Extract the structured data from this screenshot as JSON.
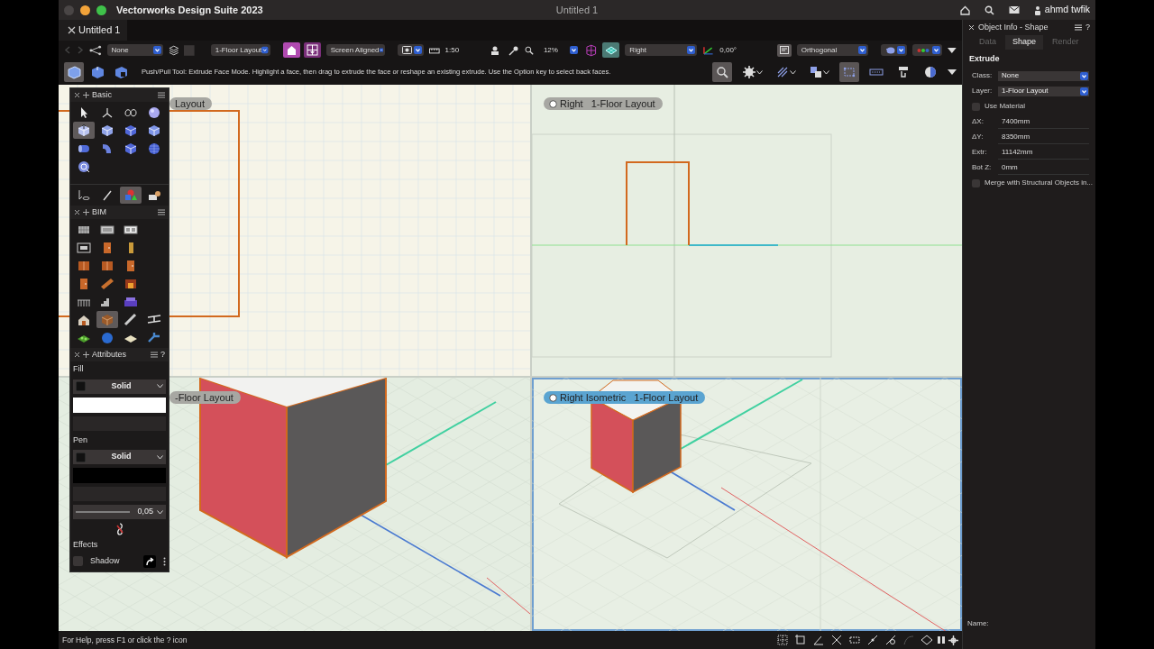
{
  "title_bar": {
    "app_title": "Vectorworks Design Suite 2023",
    "document_title": "Untitled 1",
    "user": "ahmd twfik"
  },
  "document_tab": {
    "label": "Untitled 1"
  },
  "view_bar": {
    "class": "None",
    "layer": "1-Floor Layout",
    "layer_plane_buttons": [
      {
        "selected": true
      },
      {
        "selected": false
      }
    ],
    "plane": "Screen Aligned",
    "scale": "1:50",
    "zoom": "12%",
    "view": "Right",
    "rotation": "0,00°",
    "projection": "Orthogonal"
  },
  "mode_bar": {
    "modes": [
      {
        "selected": true
      },
      {
        "selected": false
      },
      {
        "selected": false
      }
    ],
    "help": "Push/Pull Tool: Extrude Face Mode. Highlight a face, then drag to extrude the face or reshape an existing extrude. Use the Option key to select back faces.",
    "tool_buttons": [
      {
        "selected": true
      },
      {
        "selected": false
      },
      {
        "selected": false
      },
      {
        "selected": false
      },
      {
        "selected": true
      },
      {
        "selected": false
      },
      {
        "selected": false
      },
      {
        "selected": false
      }
    ]
  },
  "viewports": [
    {
      "kind": "plan",
      "layer": "Layout",
      "selected": false
    },
    {
      "kind": "elevation",
      "view": "Right",
      "layer": "1-Floor Layout",
      "selected": false
    },
    {
      "kind": "close_up",
      "layer": "-Floor Layout",
      "selected": false
    },
    {
      "kind": "isometric",
      "view": "Right Isometric",
      "layer": "1-Floor Layout",
      "selected": true
    }
  ],
  "basic_palette": {
    "title": "Basic",
    "tools": [
      {
        "selected": false
      },
      {
        "selected": false
      },
      {
        "selected": false
      },
      {
        "selected": false
      },
      {
        "selected": true
      },
      {
        "selected": false
      },
      {
        "selected": false
      },
      {
        "selected": false
      },
      {
        "selected": false
      },
      {
        "selected": false
      },
      {
        "selected": false
      },
      {
        "selected": false
      },
      {
        "selected": false
      }
    ],
    "tool_sets": [
      {
        "selected": false
      },
      {
        "selected": false
      },
      {
        "selected": true
      },
      {
        "selected": false
      }
    ]
  },
  "bim_palette": {
    "title": "BIM",
    "tools": [
      {
        "selected": false
      },
      {
        "selected": false
      },
      {
        "selected": false
      },
      {
        "selected": false
      },
      {
        "selected": false
      },
      {
        "selected": false
      },
      {
        "selected": false
      },
      {
        "selected": false
      },
      {
        "selected": false
      },
      {
        "selected": false
      },
      {
        "selected": false
      },
      {
        "selected": false
      },
      {
        "selected": false
      },
      {
        "selected": false
      },
      {
        "selected": false
      },
      {
        "selected": false
      },
      {
        "selected": true
      },
      {
        "selected": false
      },
      {
        "selected": false
      },
      {
        "selected": false
      },
      {
        "selected": false
      },
      {
        "selected": false
      },
      {
        "selected": false
      }
    ]
  },
  "attributes_palette": {
    "title": "Attributes",
    "help": "?",
    "fill": {
      "label": "Fill",
      "style": "Solid",
      "color": "#ffffff"
    },
    "pen": {
      "label": "Pen",
      "style": "Solid",
      "color": "#000000"
    },
    "line_weight": "0,05",
    "effects": {
      "label": "Effects",
      "shadow": {
        "label": "Shadow",
        "checked": false
      }
    }
  },
  "object_info": {
    "title": "Object Info - Shape",
    "help": "?",
    "tabs": [
      {
        "label": "Data",
        "selected": false
      },
      {
        "label": "Shape",
        "selected": true
      },
      {
        "label": "Render",
        "selected": false
      }
    ],
    "object_type": "Extrude",
    "fields": [
      {
        "kind": "select",
        "label": "Class:",
        "value": "None"
      },
      {
        "kind": "select",
        "label": "Layer:",
        "value": "1-Floor Layout"
      },
      {
        "kind": "checkbox",
        "label": "Use Material",
        "checked": false
      },
      {
        "kind": "text",
        "label": "ΔX:",
        "value": "7400mm"
      },
      {
        "kind": "text",
        "label": "ΔY:",
        "value": "8350mm"
      },
      {
        "kind": "text",
        "label": "Extr:",
        "value": "11142mm"
      },
      {
        "kind": "text",
        "label": "Bot Z:",
        "value": "0mm"
      },
      {
        "kind": "checkbox",
        "label": "Merge with Structural Objects in...",
        "checked": false
      }
    ],
    "name_label": "Name:"
  },
  "status_bar": {
    "help": "For Help, press F1 or click the ? icon"
  }
}
